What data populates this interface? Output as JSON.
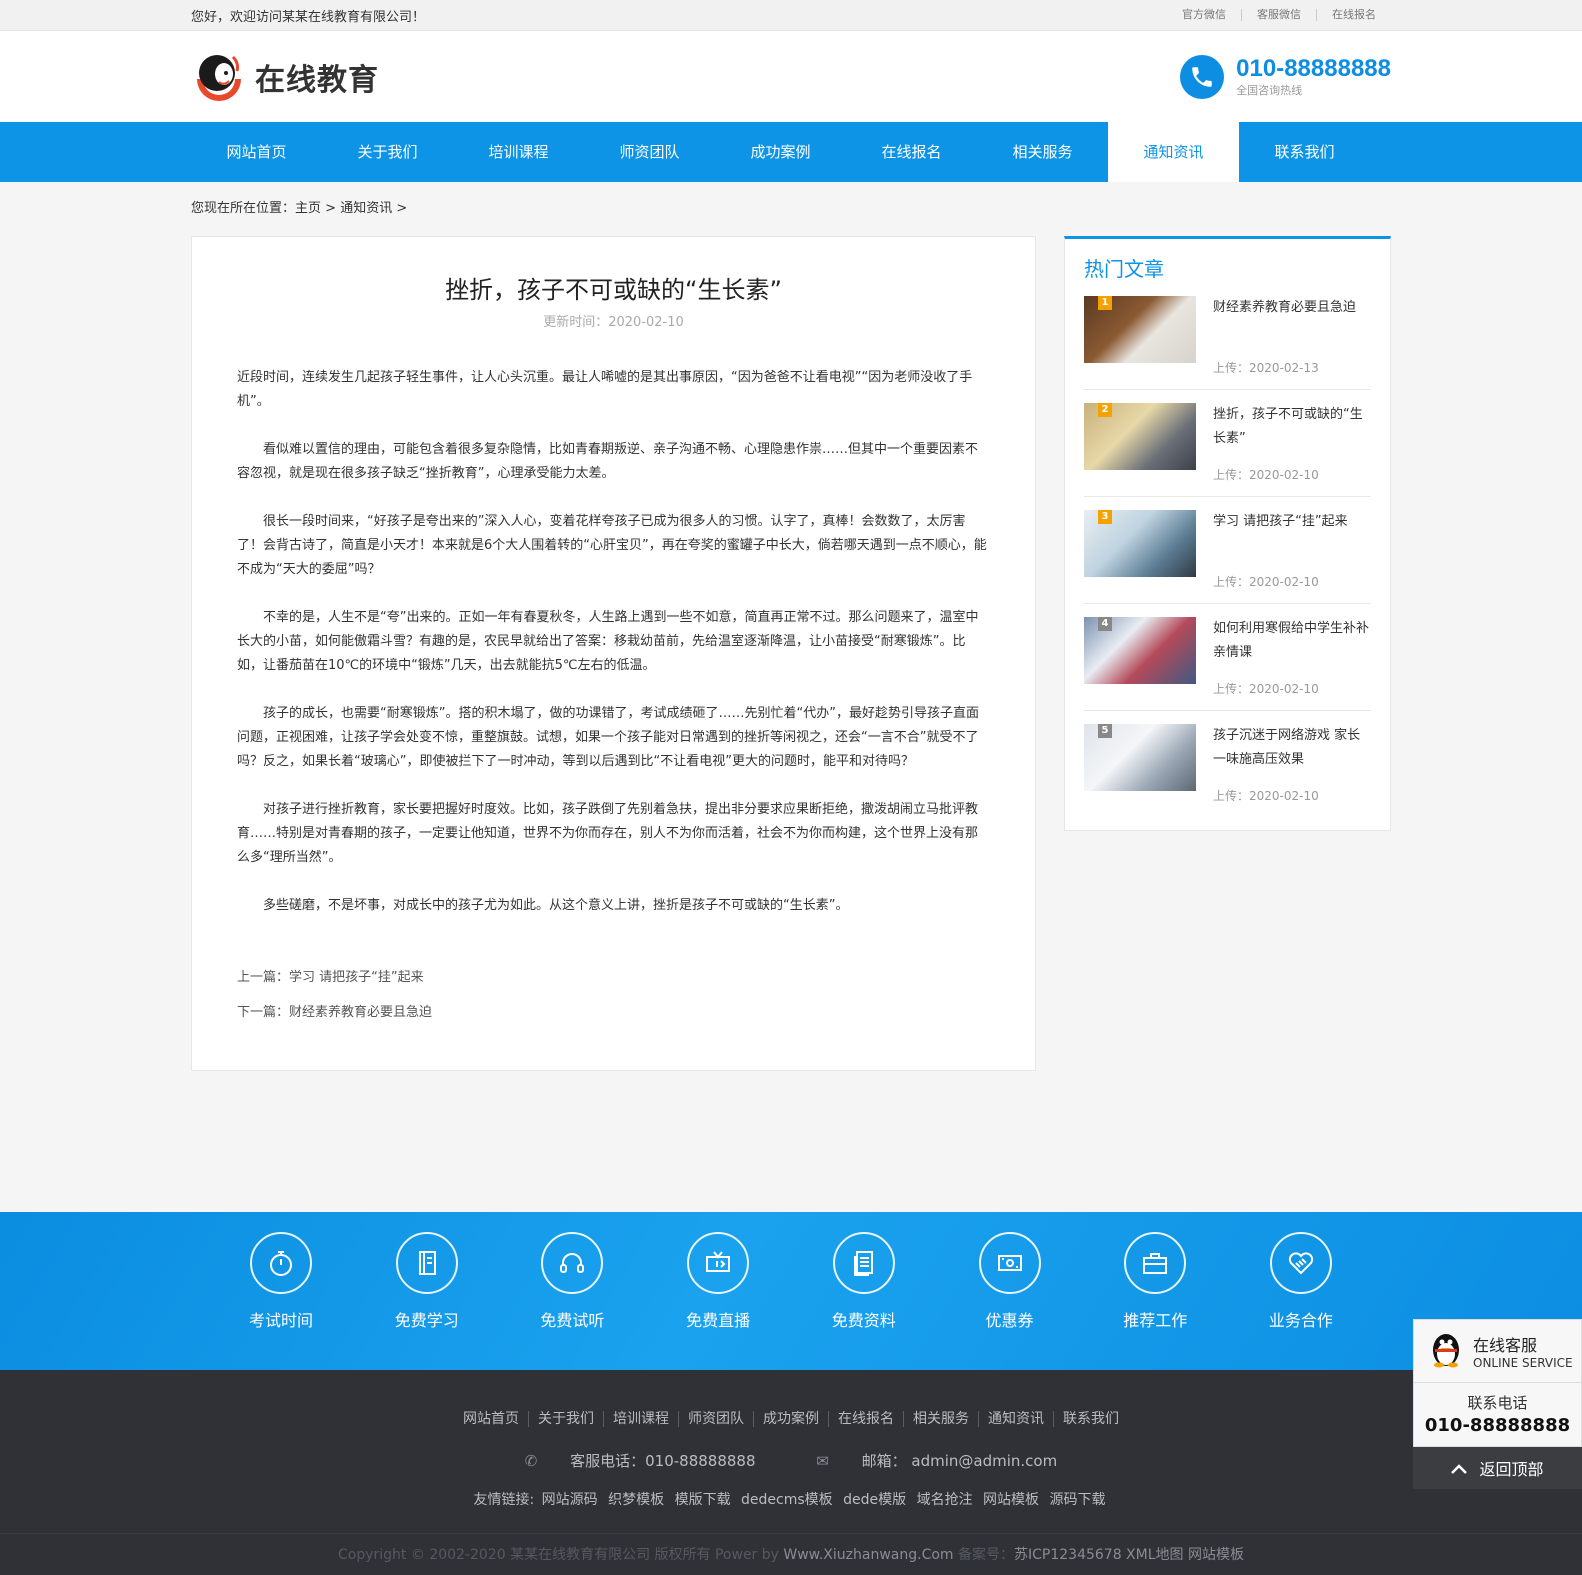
{
  "topbar": {
    "welcome": "您好，欢迎访问某某在线教育有限公司！",
    "links": [
      "官方微信",
      "客服微信",
      "在线报名"
    ]
  },
  "header": {
    "logo_text": "在线教育",
    "hotline_number": "010-88888888",
    "hotline_label": "全国咨询热线"
  },
  "nav": {
    "items": [
      "网站首页",
      "关于我们",
      "培训课程",
      "师资团队",
      "成功案例",
      "在线报名",
      "相关服务",
      "通知资讯",
      "联系我们"
    ],
    "active": "通知资讯"
  },
  "breadcrumb": {
    "prefix": "您现在所在位置：",
    "home": "主页",
    "sep": ">",
    "current": "通知资讯",
    "tail": ">"
  },
  "article": {
    "title": "挫折，孩子不可或缺的“生长素”",
    "date": "更新时间：2020-02-10",
    "paragraphs": [
      "近段时间，连续发生几起孩子轻生事件，让人心头沉重。最让人唏嘘的是其出事原因，“因为爸爸不让看电视”“因为老师没收了手机”。",
      "看似难以置信的理由，可能包含着很多复杂隐情，比如青春期叛逆、亲子沟通不畅、心理隐患作祟……但其中一个重要因素不容忽视，就是现在很多孩子缺乏“挫折教育”，心理承受能力太差。",
      "很长一段时间来，“好孩子是夸出来的”深入人心，变着花样夸孩子已成为很多人的习惯。认字了，真棒！会数数了，太厉害了！会背古诗了，简直是小天才！本来就是6个大人围着转的“心肝宝贝”，再在夸奖的蜜罐子中长大，倘若哪天遇到一点不顺心，能不成为“天大的委屈”吗？",
      "不幸的是，人生不是“夸”出来的。正如一年有春夏秋冬，人生路上遇到一些不如意，简直再正常不过。那么问题来了，温室中长大的小苗，如何能傲霜斗雪？有趣的是，农民早就给出了答案：移栽幼苗前，先给温室逐渐降温，让小苗接受“耐寒锻炼”。比如，让番茄苗在10℃的环境中“锻炼”几天，出去就能抗5℃左右的低温。",
      "孩子的成长，也需要“耐寒锻炼”。搭的积木塌了，做的功课错了，考试成绩砸了……先别忙着“代办”，最好趁势引导孩子直面问题，正视困难，让孩子学会处变不惊，重整旗鼓。试想，如果一个孩子能对日常遇到的挫折等闲视之，还会“一言不合”就受不了吗？反之，如果长着“玻璃心”，即使被拦下了一时冲动，等到以后遇到比“不让看电视”更大的问题时，能平和对待吗？",
      "对孩子进行挫折教育，家长要把握好时度效。比如，孩子跌倒了先别着急扶，提出非分要求应果断拒绝，撒泼胡闹立马批评教育……特别是对青春期的孩子，一定要让他知道，世界不为你而存在，别人不为你而活着，社会不为你而构建，这个世界上没有那么多“理所当然”。",
      "多些磋磨，不是坏事，对成长中的孩子尤为如此。从这个意义上讲，挫折是孩子不可或缺的“生长素”。"
    ],
    "prev_label": "上一篇：",
    "prev_title": "学习 请把孩子“挂”起来",
    "next_label": "下一篇：",
    "next_title": "财经素养教育必要且急迫"
  },
  "sidebar": {
    "title": "热门文章",
    "items": [
      {
        "rank": "1",
        "title": "财经素养教育必要且急迫",
        "date": "上传：2020-02-13"
      },
      {
        "rank": "2",
        "title": "挫折，孩子不可或缺的“生长素”",
        "date": "上传：2020-02-10"
      },
      {
        "rank": "3",
        "title": "学习 请把孩子“挂”起来",
        "date": "上传：2020-02-10"
      },
      {
        "rank": "4",
        "title": "如何利用寒假给中学生补补亲情课",
        "date": "上传：2020-02-10"
      },
      {
        "rank": "5",
        "title": "孩子沉迷于网络游戏 家长一味施高压效果",
        "date": "上传：2020-02-10"
      }
    ]
  },
  "services": [
    {
      "label": "考试时间",
      "icon": "stopwatch-icon"
    },
    {
      "label": "免费学习",
      "icon": "book-icon"
    },
    {
      "label": "免费试听",
      "icon": "headset-icon"
    },
    {
      "label": "免费直播",
      "icon": "live-icon"
    },
    {
      "label": "免费资料",
      "icon": "document-icon"
    },
    {
      "label": "优惠券",
      "icon": "coupon-icon"
    },
    {
      "label": "推荐工作",
      "icon": "briefcase-icon"
    },
    {
      "label": "业务合作",
      "icon": "handshake-icon"
    }
  ],
  "footer": {
    "nav": [
      "网站首页",
      "关于我们",
      "培训课程",
      "师资团队",
      "成功案例",
      "在线报名",
      "相关服务",
      "通知资讯",
      "联系我们"
    ],
    "phone": "客服电话：010-88888888",
    "email": "邮箱： admin@admin.com",
    "links_label": "友情链接:",
    "links": [
      "网站源码",
      "织梦模板",
      "模版下载",
      "dedecms模板",
      "dede模版",
      "域名抢注",
      "网站模板",
      "源码下载"
    ],
    "copyright": "Copyright © 2002-2020 某某在线教育有限公司 版权所有 Power by ",
    "power": "Www.Xiuzhanwang.Com",
    "icp_label": " 备案号：",
    "icp": "苏ICP12345678 XML地图 网站模板"
  },
  "float_service": {
    "title": "在线客服",
    "subtitle": "ONLINE SERVICE",
    "phone_label": "联系电话",
    "phone": "010-88888888",
    "back_top": "返回顶部"
  },
  "colors": {
    "primary": "#0d94e6",
    "footer_bg": "#2f3137",
    "accent_rank": "#f5a200"
  }
}
